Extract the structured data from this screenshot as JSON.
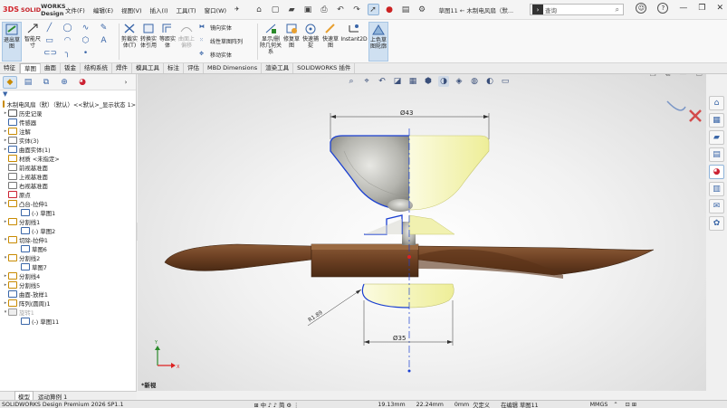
{
  "app": {
    "brand_mark": "3DS",
    "brand_solid": "SOLID",
    "brand_works": "WORKS Design",
    "document_title": "草图11 ← 木制电风扇（默..."
  },
  "menu": [
    "文件(F)",
    "编辑(E)",
    "视图(V)",
    "插入(I)",
    "工具(T)",
    "窗口(W)"
  ],
  "search": {
    "placeholder": "查询",
    "prefix_icon": "search-solidworks-icon"
  },
  "ribbon": {
    "buttons": [
      {
        "label": "退出草图",
        "icon": "exit-sketch-icon"
      },
      {
        "label": "智能尺寸",
        "icon": "smart-dimension-icon"
      },
      {
        "label": "剪裁实体(T)",
        "icon": "trim-entities-icon"
      },
      {
        "label": "转换实体引用",
        "icon": "convert-entities-icon"
      },
      {
        "label": "等距实体",
        "icon": "offset-entities-icon"
      },
      {
        "label": "曲面上偏移",
        "icon": "offset-on-surface-icon"
      },
      {
        "label": "显示/删除几何关系",
        "icon": "display-relations-icon"
      },
      {
        "label": "修复草图",
        "icon": "repair-sketch-icon"
      },
      {
        "label": "快速捕捉",
        "icon": "quick-snaps-icon"
      },
      {
        "label": "快速草图",
        "icon": "rapid-sketch-icon"
      },
      {
        "label": "Instant2D",
        "icon": "instant2d-icon"
      },
      {
        "label": "上色草图轮廓",
        "icon": "shaded-sketch-contours-icon"
      }
    ],
    "small": [
      {
        "label": "镜向实体",
        "icon": "mirror-entities-icon"
      },
      {
        "label": "线性草图阵列",
        "icon": "linear-pattern-icon"
      },
      {
        "label": "移动实体",
        "icon": "move-entities-icon"
      }
    ]
  },
  "tabs": [
    "特征",
    "草图",
    "曲面",
    "钣金",
    "结构系统",
    "焊件",
    "模具工具",
    "标注",
    "评估",
    "MBD Dimensions",
    "渲染工具",
    "SOLIDWORKS 插件"
  ],
  "active_tab": "草图",
  "tree": [
    {
      "label": "木制电风扇（默）（默认）<<默认>_显示状态 1>",
      "level": 0,
      "arrow": "",
      "icon": "part-icon"
    },
    {
      "label": "历史记录",
      "level": 0,
      "arrow": "▸",
      "icon": "history-icon"
    },
    {
      "label": "传感器",
      "level": 0,
      "arrow": "",
      "icon": "sensor-icon"
    },
    {
      "label": "注解",
      "level": 0,
      "arrow": "▸",
      "icon": "annotation-icon"
    },
    {
      "label": "实体(3)",
      "level": 0,
      "arrow": "▸",
      "icon": "solid-bodies-icon"
    },
    {
      "label": "曲面实体(1)",
      "level": 0,
      "arrow": "▸",
      "icon": "surface-bodies-icon"
    },
    {
      "label": "材质 <未指定>",
      "level": 0,
      "arrow": "",
      "icon": "material-icon"
    },
    {
      "label": "前视基准面",
      "level": 0,
      "arrow": "",
      "icon": "plane-icon"
    },
    {
      "label": "上视基准面",
      "level": 0,
      "arrow": "",
      "icon": "plane-icon"
    },
    {
      "label": "右视基准面",
      "level": 0,
      "arrow": "",
      "icon": "plane-icon"
    },
    {
      "label": "原点",
      "level": 0,
      "arrow": "",
      "icon": "origin-icon"
    },
    {
      "label": "凸台-拉伸1",
      "level": 0,
      "arrow": "▾",
      "icon": "boss-extrude-icon"
    },
    {
      "label": "(-) 草图1",
      "level": 1,
      "arrow": "",
      "icon": "sketch-icon"
    },
    {
      "label": "分割线1",
      "level": 0,
      "arrow": "▸",
      "icon": "split-line-icon"
    },
    {
      "label": "(-) 草图2",
      "level": 1,
      "arrow": "",
      "icon": "sketch-icon"
    },
    {
      "label": "切除-拉伸1",
      "level": 0,
      "arrow": "▾",
      "icon": "cut-extrude-icon"
    },
    {
      "label": "草图6",
      "level": 1,
      "arrow": "",
      "icon": "sketch-icon"
    },
    {
      "label": "分割线2",
      "level": 0,
      "arrow": "▾",
      "icon": "split-line-icon"
    },
    {
      "label": "草图7",
      "level": 1,
      "arrow": "",
      "icon": "sketch-icon"
    },
    {
      "label": "分割线4",
      "level": 0,
      "arrow": "▸",
      "icon": "split-line-icon"
    },
    {
      "label": "分割线5",
      "level": 0,
      "arrow": "▸",
      "icon": "split-line-icon"
    },
    {
      "label": "曲面-放样1",
      "level": 0,
      "arrow": "",
      "icon": "surface-loft-icon"
    },
    {
      "label": "阵列(圆周)1",
      "level": 0,
      "arrow": "▸",
      "icon": "circular-pattern-icon"
    },
    {
      "label": "旋转1",
      "level": 0,
      "arrow": "▾",
      "icon": "revolve-icon",
      "faded": true
    },
    {
      "label": "(-) 草图11",
      "level": 1,
      "arrow": "",
      "icon": "sketch-icon"
    }
  ],
  "dims": {
    "top_dia": "Ø43",
    "bottom_dia": "Ø35",
    "leader": "R1.89"
  },
  "viewport": {
    "new_view_label": "*新视"
  },
  "bottom_tabs": [
    "模型",
    "运动算例 1"
  ],
  "status": {
    "app_version": "SOLIDWORKS Design Premium 2026 SP1.1",
    "x": "19.13mm",
    "y": "22.24mm",
    "z": "0mm",
    "state": "欠定义",
    "editing": "在编辑 草图11",
    "units": "MMGS"
  },
  "colors": {
    "accent": "#1f5fb8",
    "brand": "#d1232a",
    "wood": "#7a4a2a",
    "sketch_blue": "#1a3fd1"
  }
}
